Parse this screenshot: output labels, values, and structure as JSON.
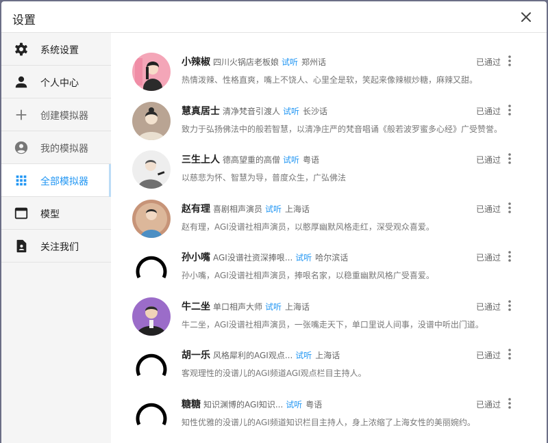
{
  "dialog": {
    "title": "设置"
  },
  "sidebar": {
    "items": [
      {
        "label": "系统设置",
        "icon": "gear-icon"
      },
      {
        "label": "个人中心",
        "icon": "person-icon"
      },
      {
        "label": "创建模拟器",
        "icon": "plus-icon"
      },
      {
        "label": "我的模拟器",
        "icon": "account-circle-icon"
      },
      {
        "label": "全部模拟器",
        "icon": "grid-icon"
      },
      {
        "label": "模型",
        "icon": "window-icon"
      },
      {
        "label": "关注我们",
        "icon": "contact-card-icon"
      }
    ],
    "active_index": 4
  },
  "simulators": [
    {
      "name": "小辣椒",
      "role": "四川火锅店老板娘",
      "listen": "试听",
      "dialect": "郑州话",
      "desc": "热情泼辣、性格直爽，嘴上不饶人、心里全是软，笑起来像辣椒炒糖，麻辣又甜。",
      "status": "已通过"
    },
    {
      "name": "慧真居士",
      "role": "清净梵音引渡人",
      "listen": "试听",
      "dialect": "长沙话",
      "desc": "致力于弘扬佛法中的般若智慧，以清净庄严的梵音唱诵《般若波罗蜜多心经》广受赞誉。",
      "status": "已通过"
    },
    {
      "name": "三生上人",
      "role": "德高望重的高僧",
      "listen": "试听",
      "dialect": "粤语",
      "desc": "以慈悲为怀、智慧为导，普度众生，广弘佛法",
      "status": "已通过"
    },
    {
      "name": "赵有理",
      "role": "喜剧相声演员",
      "listen": "试听",
      "dialect": "上海话",
      "desc": "赵有理，AGI没谱社相声演员，以憨厚幽默风格走红，深受观众喜爱。",
      "status": "已通过"
    },
    {
      "name": "孙小嘴",
      "role": "AGI没谱社资深捧哏...",
      "listen": "试听",
      "dialect": "哈尔滨话",
      "desc": "孙小嘴，AGI没谱社相声演员，捧哏名家，以稳重幽默风格广受喜爱。",
      "status": "已通过"
    },
    {
      "name": "牛二坐",
      "role": "单口相声大师",
      "listen": "试听",
      "dialect": "上海话",
      "desc": "牛二坐，AGI没谱社相声演员，一张嘴走天下，单口里说人间事，没谱中听出门道。",
      "status": "已通过"
    },
    {
      "name": "胡一乐",
      "role": "风格犀利的AGI观点...",
      "listen": "试听",
      "dialect": "上海话",
      "desc": "客观理性的没谱儿的AGI频道AGI观点栏目主持人。",
      "status": "已通过"
    },
    {
      "name": "糖糖",
      "role": "知识渊博的AGI知识...",
      "listen": "试听",
      "dialect": "粤语",
      "desc": "知性优雅的没谱儿的AGI频道知识栏目主持人，身上浓缩了上海女性的美丽婉约。",
      "status": "已通过"
    }
  ],
  "colors": {
    "accent": "#2196f3",
    "sidebar_bg": "#f5f5f5",
    "backdrop": "#6b6e86"
  }
}
